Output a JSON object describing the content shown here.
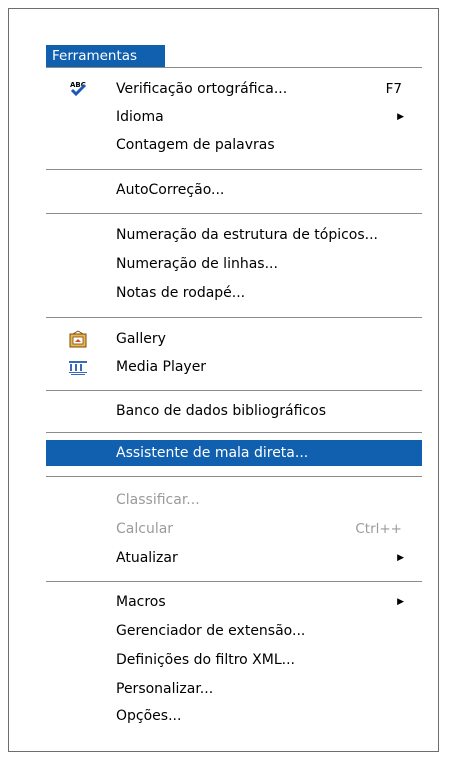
{
  "menu_title": "Ferramentas",
  "items": [
    {
      "label": "Verificação ortográfica...",
      "shortcut": "F7",
      "icon": "spellcheck-abc-icon"
    },
    {
      "label": "Idioma",
      "submenu": true
    },
    {
      "label": "Contagem de palavras"
    },
    {
      "label": "AutoCorreção..."
    },
    {
      "label": "Numeração da estrutura de tópicos..."
    },
    {
      "label": "Numeração de linhas..."
    },
    {
      "label": "Notas de rodapé..."
    },
    {
      "label": "Gallery",
      "icon": "gallery-icon"
    },
    {
      "label": "Media Player",
      "icon": "media-player-icon"
    },
    {
      "label": "Banco de dados bibliográficos"
    },
    {
      "label": "Assistente de mala direta...",
      "highlighted": true
    },
    {
      "label": "Classificar...",
      "disabled": true
    },
    {
      "label": "Calcular",
      "shortcut": "Ctrl++",
      "disabled": true
    },
    {
      "label": "Atualizar",
      "submenu": true
    },
    {
      "label": "Macros",
      "submenu": true
    },
    {
      "label": "Gerenciador de extensão..."
    },
    {
      "label": "Definições do filtro XML..."
    },
    {
      "label": "Personalizar..."
    },
    {
      "label": "Opções..."
    }
  ],
  "colors": {
    "highlight": "#1160b0",
    "disabled": "#9b9b9b",
    "separator": "#8c8c8c"
  }
}
